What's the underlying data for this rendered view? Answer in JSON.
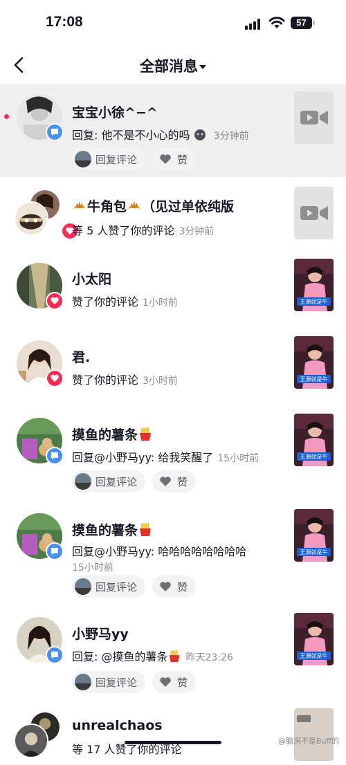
{
  "status": {
    "time": "17:08",
    "battery": "57"
  },
  "nav": {
    "title": "全部消息"
  },
  "reply_label": "回复评论",
  "like_label": "赞",
  "items": [
    {
      "name": "宝宝小徐^−^",
      "message": "回复: 他不是不小心的吗",
      "time": "3分钟前"
    },
    {
      "name": "牛角包",
      "name_suffix": "（见过单依纯版",
      "message": "等 5 人赞了你的评论",
      "time": "3分钟前"
    },
    {
      "name": "小太阳",
      "message": "赞了你的评论",
      "time": "1小时前"
    },
    {
      "name": "君.",
      "message": "赞了你的评论",
      "time": "3小时前"
    },
    {
      "name": "摸鱼的薯条",
      "message": "回复@小野马yy: 给我笑醒了",
      "time": "15小时前"
    },
    {
      "name": "摸鱼的薯条",
      "message": "回复@小野马yy: 哈哈哈哈哈哈哈哈",
      "time": "15小时前"
    },
    {
      "name": "小野马yy",
      "message": "回复: @摸鱼的薯条",
      "time": "昨天23:26"
    },
    {
      "name": "unrealchaos",
      "message": "等 17 人赞了你的评论"
    }
  ],
  "thumb_caption": "王源就是牛",
  "watermark": "@脑洞不是Buff的",
  "icons": [
    "chevron-left-icon",
    "caret-down-icon",
    "comment-icon",
    "heart-icon",
    "video-camera-icon",
    "signal-icon",
    "wifi-icon",
    "battery-icon"
  ],
  "colors": {
    "accent": "#fe2c55",
    "comment_badge": "#4a90f0",
    "unread_bg": "#efefef"
  }
}
